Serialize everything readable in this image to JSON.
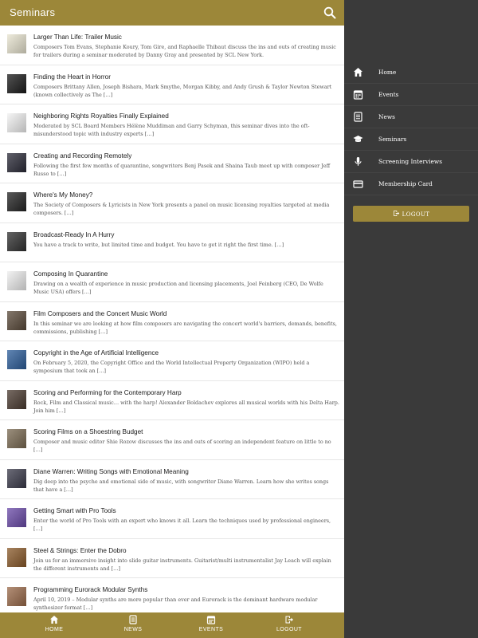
{
  "header": {
    "title": "Seminars",
    "search_icon": "search-icon"
  },
  "seminars": [
    {
      "title": "Larger Than Life: Trailer Music",
      "desc": "Composers Tom Evans, Stephanie Koury, Tom Gire, and Raphaelle Thibaut discuss the ins and outs of creating music for trailers during a seminar moderated by Danny Gray and presented by SCL New York."
    },
    {
      "title": "Finding the Heart in Horror",
      "desc": "Composers Brittany Allen, Joseph Bishara, Mark Smythe, Morgan Kibby, and Andy Grush & Taylor Newton Stewart (known collectively as The […]"
    },
    {
      "title": "Neighboring Rights Royalties Finally Explained",
      "desc": "Moderated by SCL Board Members Hélène Muddiman and Garry Schyman, this seminar dives into the oft-misunderstood topic with industry experts […]"
    },
    {
      "title": "Creating and Recording Remotely",
      "desc": "Following the first few months of quarantine, songwriters Benj Pasek and Shaina Taub meet up with composer Jeff Russo to […]"
    },
    {
      "title": "Where's My Money?",
      "desc": "The Society of Composers & Lyricists in New York presents a panel on music licensing royalties targeted at media composers. […]"
    },
    {
      "title": "Broadcast-Ready In A Hurry",
      "desc": "You have a track to write, but limited time and budget. You have to get it right the first time. […]"
    },
    {
      "title": "Composing In Quarantine",
      "desc": "Drawing on a wealth of experience in music production and licensing placements, Joel Feinberg (CEO, De Wolfe Music USA) offers […]"
    },
    {
      "title": "Film Composers and the Concert Music World",
      "desc": "In this seminar we are looking at how film composers are navigating the concert world's barriers, demands, benefits, commissions, publishing […]"
    },
    {
      "title": "Copyright in the Age of Artificial Intelligence",
      "desc": "On February 5, 2020, the Copyright Office and the World Intellectual Property Organization (WIPO) held a symposium that took an […]"
    },
    {
      "title": "Scoring and Performing for the Contemporary Harp",
      "desc": "Rock, Film and Classical music… with the harp! Alexander Boldachev explores all musical worlds with his Delta Harp. Join him […]"
    },
    {
      "title": "Scoring Films on a Shoestring Budget",
      "desc": "Composer and music editor Shie Rozow discusses the ins and outs of scoring an independent feature on little to no […]"
    },
    {
      "title": "Diane Warren: Writing Songs with Emotional Meaning",
      "desc": "Dig deep into the psyche and emotional side of music, with songwriter Diane Warren. Learn how she writes songs that have a […]"
    },
    {
      "title": "Getting Smart with Pro Tools",
      "desc": "Enter the world of Pro Tools with an expert who knows it all. Learn the techniques used by professional engineers, […]"
    },
    {
      "title": "Steel & Strings: Enter the Dobro",
      "desc": "Join us for an immersive insight into slide guitar instruments. Guitarist/multi instrumentalist Jay Leach will explain the different instruments and […]"
    },
    {
      "title": "Programming Eurorack Modular Synths",
      "desc": "April 10, 2019 – Modular synths are more popular than ever and Eurorack is the dominant hardware modular synthesizer format […]"
    }
  ],
  "thumb_colors": [
    "#e8e4d0",
    "#1a1a1a",
    "#f2f2f2",
    "#2b2b38",
    "#222222",
    "#303030",
    "#eeeeee",
    "#5a4a3a",
    "#2c5d9a",
    "#4a3a30",
    "#7a6a52",
    "#3a3a4a",
    "#6a4aa8",
    "#8a5a2a",
    "#9a6a4a"
  ],
  "drawer": {
    "menu": [
      {
        "label": "Home",
        "icon": "home-icon"
      },
      {
        "label": "Events",
        "icon": "calendar-icon"
      },
      {
        "label": "News",
        "icon": "news-icon"
      },
      {
        "label": "Seminars",
        "icon": "graduation-cap-icon"
      },
      {
        "label": "Screening Interviews",
        "icon": "microphone-icon"
      },
      {
        "label": "Membership Card",
        "icon": "card-icon"
      }
    ],
    "logout_label": "LOGOUT"
  },
  "tabs": [
    {
      "label": "HOME",
      "icon": "home-icon"
    },
    {
      "label": "NEWS",
      "icon": "news-icon"
    },
    {
      "label": "EVENTS",
      "icon": "calendar-icon"
    },
    {
      "label": "LOGOUT",
      "icon": "logout-icon"
    }
  ],
  "colors": {
    "accent": "#9c8739",
    "drawer_bg": "#3a3a3a",
    "text": "#1a1a1a",
    "muted": "#555555"
  }
}
